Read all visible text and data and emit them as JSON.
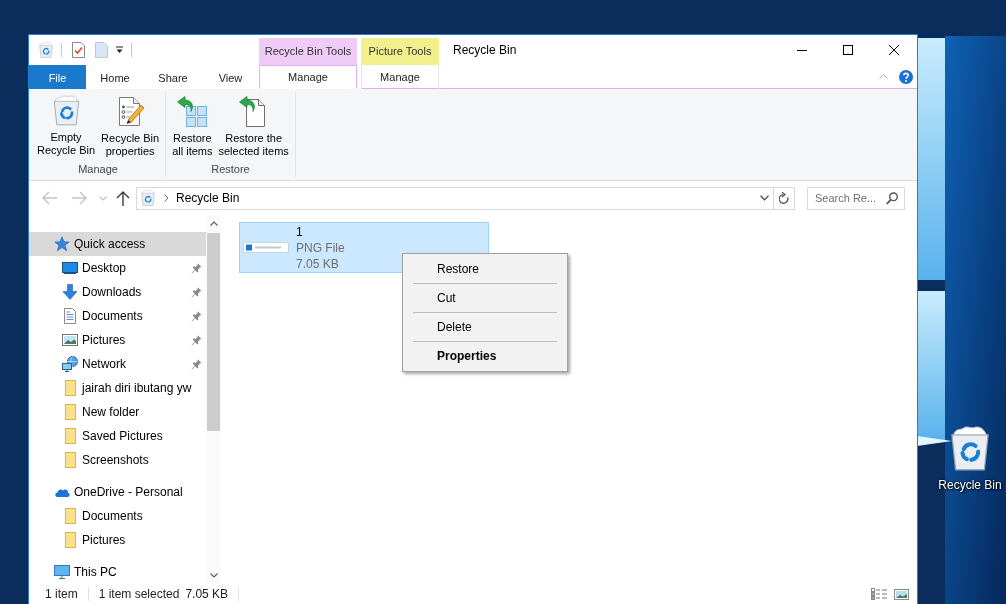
{
  "desktop": {
    "icons": [
      {
        "label": "Recycle Bin"
      }
    ]
  },
  "window": {
    "title": "Recycle Bin",
    "ribbon": {
      "tabs": [
        {
          "label": "File",
          "kind": "file",
          "selected": false
        },
        {
          "label": "Home",
          "kind": "plain",
          "selected": false
        },
        {
          "label": "Share",
          "kind": "plain",
          "selected": false
        },
        {
          "label": "View",
          "kind": "plain",
          "selected": false
        }
      ],
      "contextual_groups": [
        {
          "label": "Recycle Bin Tools",
          "color": "#efcbf7",
          "tab": {
            "label": "Manage",
            "selected": true
          }
        },
        {
          "label": "Picture Tools",
          "color": "#f2f08d",
          "tab": {
            "label": "Manage",
            "selected": false
          }
        }
      ],
      "groups": [
        {
          "label": "Manage",
          "commands": [
            {
              "label": "Empty\nRecycle Bin",
              "kind": "empty"
            },
            {
              "label": "Recycle Bin\nproperties",
              "kind": "properties"
            }
          ]
        },
        {
          "label": "Restore",
          "commands": [
            {
              "label": "Restore\nall items",
              "kind": "restoreall"
            },
            {
              "label": "Restore the\nselected items",
              "kind": "restoreselected"
            }
          ]
        }
      ]
    },
    "nav_buttons": [
      {
        "kind": "back",
        "disabled": true
      },
      {
        "kind": "forward",
        "disabled": true
      },
      {
        "kind": "recent",
        "disabled": true
      },
      {
        "kind": "up",
        "disabled": false
      }
    ],
    "address_bar": {
      "path": [
        {
          "label": "Recycle Bin"
        }
      ]
    },
    "search": {
      "placeholder": "Search Re..."
    },
    "navigation_pane": {
      "items": [
        {
          "label": "Quick access",
          "kind": "quickaccess",
          "selected": true,
          "pinned": false,
          "children": [
            {
              "label": "Desktop",
              "kind": "desktop",
              "selected": false,
              "pinned": true
            },
            {
              "label": "Downloads",
              "kind": "downloads",
              "selected": false,
              "pinned": true
            },
            {
              "label": "Documents",
              "kind": "documents",
              "selected": false,
              "pinned": true
            },
            {
              "label": "Pictures",
              "kind": "pictures",
              "selected": false,
              "pinned": true
            },
            {
              "label": "Network",
              "kind": "network",
              "selected": false,
              "pinned": true
            },
            {
              "label": "jairah diri ibutang yw",
              "kind": "folder",
              "selected": false,
              "pinned": false
            },
            {
              "label": "New folder",
              "kind": "folder",
              "selected": false,
              "pinned": false
            },
            {
              "label": "Saved Pictures",
              "kind": "folder",
              "selected": false,
              "pinned": false
            },
            {
              "label": "Screenshots",
              "kind": "folder",
              "selected": false,
              "pinned": false
            }
          ]
        },
        {
          "label": "OneDrive - Personal",
          "kind": "cloud",
          "selected": false,
          "pinned": false,
          "children": [
            {
              "label": "Documents",
              "kind": "folder",
              "selected": false,
              "pinned": false
            },
            {
              "label": "Pictures",
              "kind": "folder",
              "selected": false,
              "pinned": false
            }
          ]
        },
        {
          "label": "This PC",
          "kind": "pc",
          "selected": false,
          "pinned": false
        }
      ]
    },
    "files": [
      {
        "name": "1",
        "type": "PNG File",
        "size": "7.05 KB",
        "selected": true
      }
    ],
    "status_bar": {
      "item_count": "1 item",
      "selection": "1 item selected",
      "selection_size": "7.05 KB"
    }
  },
  "context_menu": {
    "items": [
      {
        "label": "Restore",
        "default": false
      },
      {
        "label": "Cut",
        "default": false
      },
      {
        "label": "Delete",
        "default": false
      },
      {
        "label": "Properties",
        "default": true
      }
    ]
  }
}
